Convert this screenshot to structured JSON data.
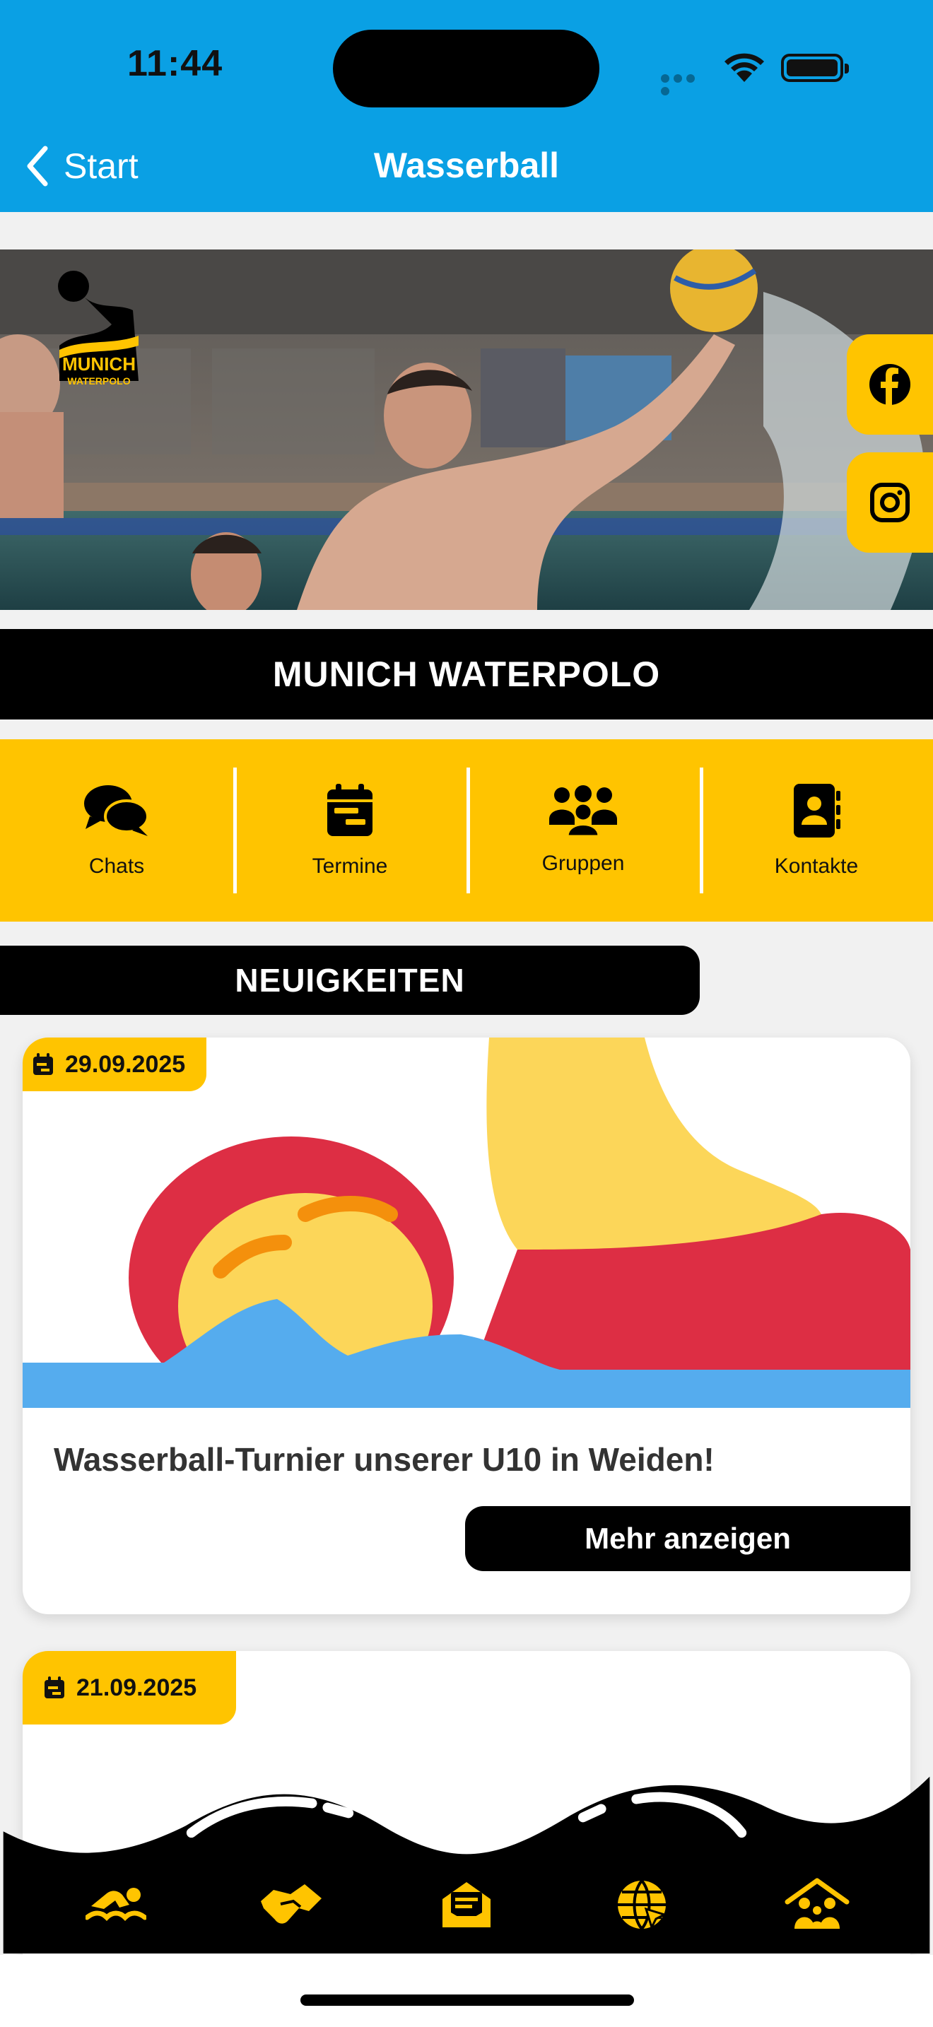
{
  "status": {
    "time": "11:44"
  },
  "nav": {
    "back_label": "Start",
    "title": "Wasserball"
  },
  "hero": {
    "logo_text_1": "MUNICH",
    "logo_text_2": "WATERPOLO"
  },
  "club": {
    "name": "MUNICH WATERPOLO"
  },
  "quick_actions": [
    {
      "label": "Chats",
      "icon": "chat-bubbles-icon"
    },
    {
      "label": "Termine",
      "icon": "calendar-icon"
    },
    {
      "label": "Gruppen",
      "icon": "group-icon"
    },
    {
      "label": "Kontakte",
      "icon": "contacts-book-icon"
    }
  ],
  "news": {
    "heading": "NEUIGKEITEN",
    "items": [
      {
        "date": "29.09.2025",
        "title": "Wasserball-Turnier unserer U10 in Weiden!",
        "button": "Mehr anzeigen"
      },
      {
        "date": "21.09.2025"
      }
    ]
  },
  "tabbar": {
    "icons": [
      "swimmer-icon",
      "handshake-icon",
      "mail-icon",
      "globe-icon",
      "family-home-icon"
    ]
  },
  "colors": {
    "accent": "#ffc400",
    "header": "#0aa0e4",
    "dark": "#000000"
  }
}
